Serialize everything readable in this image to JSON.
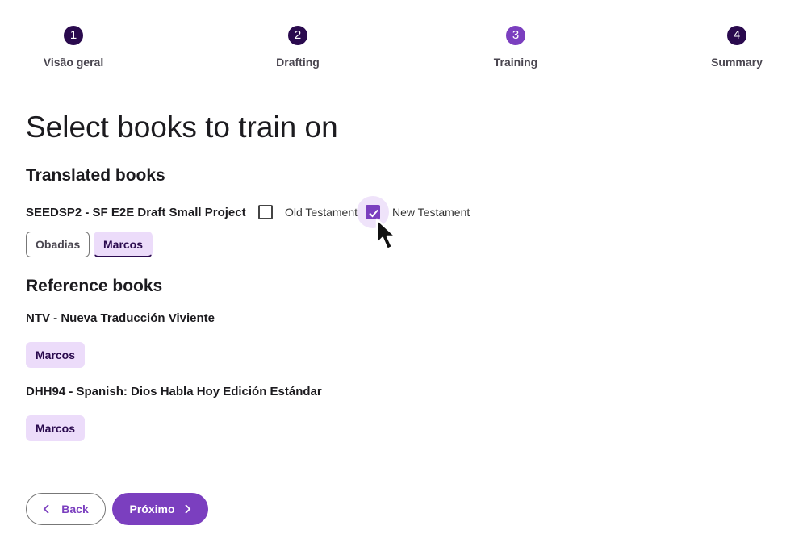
{
  "stepper": {
    "steps": [
      {
        "number": "1",
        "label": "Visão geral"
      },
      {
        "number": "2",
        "label": "Drafting"
      },
      {
        "number": "3",
        "label": "Training"
      },
      {
        "number": "4",
        "label": "Summary"
      }
    ]
  },
  "title": "Select books to train on",
  "translated": {
    "heading": "Translated books",
    "project": "SEEDSP2 - SF E2E Draft Small Project",
    "old_testament_label": "Old Testament",
    "old_testament_checked": false,
    "new_testament_label": "New Testament",
    "new_testament_checked": true,
    "books": [
      "Obadias",
      "Marcos"
    ]
  },
  "reference": {
    "heading": "Reference books",
    "sources": [
      {
        "name": "NTV - Nueva Traducción Viviente",
        "books": [
          "Marcos"
        ]
      },
      {
        "name": "DHH94 - Spanish: Dios Habla Hoy Edición Estándar",
        "books": [
          "Marcos"
        ]
      }
    ]
  },
  "buttons": {
    "back": "Back",
    "next": "Próximo"
  },
  "colors": {
    "primary": "#7b3fbf",
    "dark": "#2a0a4e",
    "chip": "#ecdcfa"
  }
}
